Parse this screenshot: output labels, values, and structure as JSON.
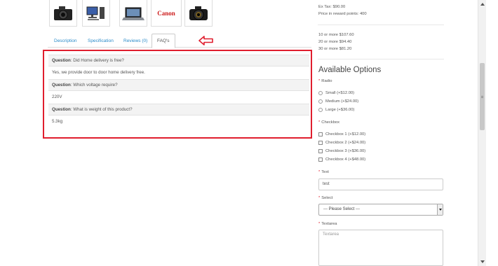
{
  "thumbnails": [
    {
      "name": "camera-thumbnail"
    },
    {
      "name": "desktop-computer-thumbnail"
    },
    {
      "name": "laptop-thumbnail"
    },
    {
      "name": "canon-logo-thumbnail",
      "text": "Canon"
    },
    {
      "name": "dslr-camera-thumbnail"
    }
  ],
  "tabs": [
    "Description",
    "Specification",
    "Reviews (0)",
    "FAQ's"
  ],
  "active_tab": "FAQ's",
  "faq": [
    {
      "q_label": "Question",
      "question": ": Did Home delivery is free?",
      "answer": "Yes, we provide door to door home delivery free."
    },
    {
      "q_label": "Question",
      "question": ": Which voltage require?",
      "answer": "220V"
    },
    {
      "q_label": "Question",
      "question": ": What is weight of this product?",
      "answer": "5.3kg"
    }
  ],
  "pricing": {
    "ex_tax": "Ex Tax: $90.00",
    "reward": "Price in reward points: 400",
    "discounts": [
      "10 or more $107.60",
      "20 or more $94.40",
      "30 or more $81.20"
    ]
  },
  "options": {
    "title": "Available Options",
    "required_mark": "*",
    "radio_label": "Radio",
    "radio_items": [
      "Small (+$12.00)",
      "Medium (+$24.00)",
      "Large (+$36.00)"
    ],
    "checkbox_label": "Checkbox",
    "checkbox_items": [
      "Checkbox 1 (+$12.00)",
      "Checkbox 2 (+$24.00)",
      "Checkbox 3 (+$36.00)",
      "Checkbox 4 (+$48.00)"
    ],
    "text_label": "Text",
    "text_value": "test",
    "select_label": "Select",
    "select_value": "--- Please Select ---",
    "textarea_label": "Textarea",
    "textarea_placeholder": "Textarea"
  },
  "colors": {
    "highlight": "#e01e2e",
    "link": "#2a8bc9"
  }
}
